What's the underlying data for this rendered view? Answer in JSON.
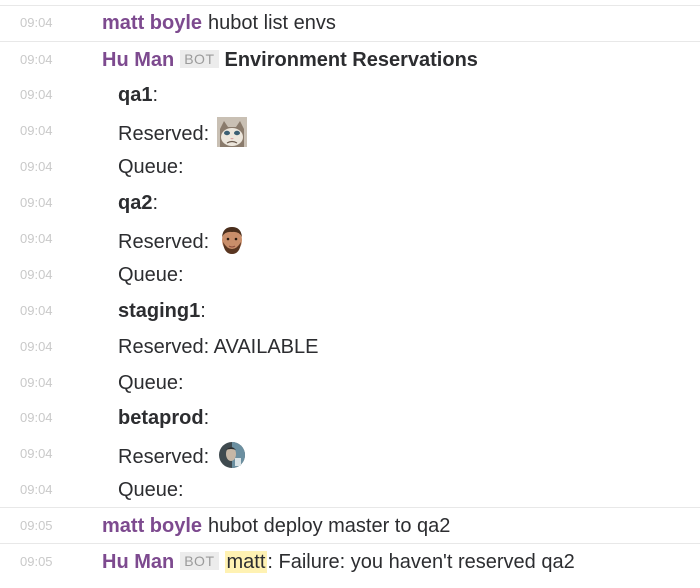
{
  "messages": [
    {
      "time": "09:04",
      "sender": "matt boyle",
      "text": "hubot list envs"
    },
    {
      "time": "09:04",
      "sender": "Hu Man",
      "badge": "BOT",
      "title": "Environment Reservations"
    },
    {
      "time": "09:04",
      "env": "qa1",
      "colon": ":"
    },
    {
      "time": "09:04",
      "label": "Reserved:",
      "avatar": "grumpy-cat-avatar-icon"
    },
    {
      "time": "09:04",
      "label": "Queue:"
    },
    {
      "time": "09:04",
      "env": "qa2",
      "colon": ":"
    },
    {
      "time": "09:04",
      "label": "Reserved:",
      "avatar": "bearded-man-avatar-icon"
    },
    {
      "time": "09:04",
      "label": "Queue:"
    },
    {
      "time": "09:04",
      "env": "staging1",
      "colon": ":"
    },
    {
      "time": "09:04",
      "label": "Reserved: AVAILABLE"
    },
    {
      "time": "09:04",
      "label": "Queue:"
    },
    {
      "time": "09:04",
      "env": "betaprod",
      "colon": ":"
    },
    {
      "time": "09:04",
      "label": "Reserved:",
      "avatar": "round-photo-avatar-icon"
    },
    {
      "time": "09:04",
      "label": "Queue:"
    },
    {
      "time": "09:05",
      "sender": "matt boyle",
      "text": "hubot deploy master to qa2"
    },
    {
      "time": "09:05",
      "sender": "Hu Man",
      "badge": "BOT",
      "mention": "matt",
      "text": ": Failure: you haven't reserved qa2"
    }
  ],
  "colors": {
    "sender": "#7d4a8f",
    "timestamp": "#c9c9c9",
    "mention_highlight": "#fff2b3",
    "bot_badge_bg": "#ececec"
  }
}
